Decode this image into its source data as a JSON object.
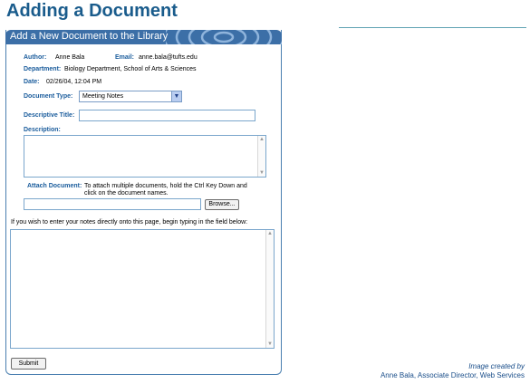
{
  "page": {
    "title": "Adding a Document"
  },
  "panel": {
    "title": "Add a New Document to the Library"
  },
  "form": {
    "author_label": "Author:",
    "author_value": "Anne Bala",
    "email_label": "Email:",
    "email_value": "anne.bala@tufts.edu",
    "department_label": "Department:",
    "department_value": "Biology Department, School of Arts & Sciences",
    "date_label": "Date:",
    "date_value": "02/26/04, 12:04 PM",
    "doctype_label": "Document Type:",
    "doctype_value": "Meeting Notes",
    "title_label": "Descriptive Title:",
    "title_value": "",
    "description_label": "Description:",
    "description_value": "",
    "attach_label": "Attach Document:",
    "attach_help_line1": "To attach multiple documents, hold the Ctrl Key Down and",
    "attach_help_line2": "click on the document names.",
    "attach_value": "",
    "browse_label": "Browse...",
    "notes_prompt": "If you wish to enter your notes directly onto this page, begin typing in the field below:",
    "notes_value": "",
    "submit_label": "Submit"
  },
  "credit": {
    "line1": "Image created by",
    "line2": "Anne Bala, Associate Director, Web Services"
  },
  "colors": {
    "heading": "#1a5c8c",
    "panel_header": "#3c6fa7",
    "label": "#1a5c9c"
  }
}
